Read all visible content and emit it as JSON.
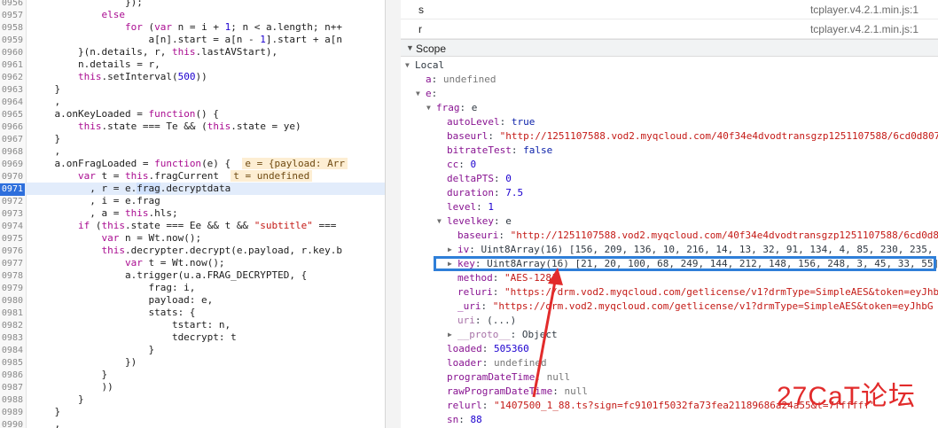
{
  "source": {
    "lines": [
      {
        "n": "0956",
        "html": "                <span>});</span>"
      },
      {
        "n": "0957",
        "html": "            <span class=\"k\">else</span>"
      },
      {
        "n": "0958",
        "html": "                <span class=\"k\">for</span> (<span class=\"k\">var</span> n = i + <span class=\"n\">1</span>; n &lt; a.length; n++"
      },
      {
        "n": "0959",
        "html": "                    a[n].start = a[n - <span class=\"n\">1</span>].start + a[n"
      },
      {
        "n": "0960",
        "html": "        }(n.details, r, <span class=\"k\">this</span>.lastAVStart),"
      },
      {
        "n": "0961",
        "html": "        n.details = r,"
      },
      {
        "n": "0962",
        "html": "        <span class=\"k\">this</span>.setInterval(<span class=\"n\">500</span>))"
      },
      {
        "n": "0963",
        "html": "    }"
      },
      {
        "n": "0964",
        "html": "    ,"
      },
      {
        "n": "0965",
        "html": "    a.onKeyLoaded = <span class=\"k\">function</span>() {"
      },
      {
        "n": "0966",
        "html": "        <span class=\"k\">this</span>.state === Te &amp;&amp; (<span class=\"k\">this</span>.state = ye)"
      },
      {
        "n": "0967",
        "html": "    }"
      },
      {
        "n": "0968",
        "html": "    ,"
      },
      {
        "n": "0969",
        "html": "    a.onFragLoaded = <span class=\"k\">function</span>(e) {  <span class=\"inline-val\">e = {payload: Arr</span>"
      },
      {
        "n": "0970",
        "html": "        <span class=\"k\">var</span> t = <span class=\"k\">this</span>.fragCurrent  <span class=\"inline-val\">t = undefined</span>"
      },
      {
        "n": "0971",
        "html": "          , r = e.<span class=\"sel\">frag</span>.decryptdata",
        "current": true
      },
      {
        "n": "0972",
        "html": "          , i = e.frag"
      },
      {
        "n": "0973",
        "html": "          , a = <span class=\"k\">this</span>.hls;"
      },
      {
        "n": "0974",
        "html": "        <span class=\"k\">if</span> (<span class=\"k\">this</span>.state === Ee &amp;&amp; t &amp;&amp; <span class=\"s\">\"subtitle\"</span> ==="
      },
      {
        "n": "0975",
        "html": "            <span class=\"k\">var</span> n = Wt.now();"
      },
      {
        "n": "0976",
        "html": "            <span class=\"k\">this</span>.decrypter.decrypt(e.payload, r.key.b"
      },
      {
        "n": "0977",
        "html": "                <span class=\"k\">var</span> t = Wt.now();"
      },
      {
        "n": "0978",
        "html": "                a.trigger(u.a.FRAG_DECRYPTED, {"
      },
      {
        "n": "0979",
        "html": "                    frag: i,"
      },
      {
        "n": "0980",
        "html": "                    payload: e,"
      },
      {
        "n": "0981",
        "html": "                    stats: {"
      },
      {
        "n": "0982",
        "html": "                        tstart: n,"
      },
      {
        "n": "0983",
        "html": "                        tdecrypt: t"
      },
      {
        "n": "0984",
        "html": "                    }"
      },
      {
        "n": "0985",
        "html": "                })"
      },
      {
        "n": "0986",
        "html": "            }"
      },
      {
        "n": "0987",
        "html": "            ))"
      },
      {
        "n": "0988",
        "html": "        }"
      },
      {
        "n": "0989",
        "html": "    }"
      },
      {
        "n": "0990",
        "html": "    ,"
      }
    ]
  },
  "call_stack": [
    {
      "fn": "s",
      "loc": "tcplayer.v4.2.1.min.js:1"
    },
    {
      "fn": "r",
      "loc": "tcplayer.v4.2.1.min.js:1"
    }
  ],
  "scope": {
    "header": "Scope",
    "rows": [
      {
        "i": 0,
        "arrow": "▼",
        "name": "Local",
        "val": "",
        "vc": "plain",
        "nc": "plain"
      },
      {
        "i": 1,
        "arrow": "",
        "name": "a",
        "val": "undefined",
        "vc": "vgray"
      },
      {
        "i": 1,
        "arrow": "▼",
        "name": "e",
        "val": "",
        "vc": "vobj"
      },
      {
        "i": 2,
        "arrow": "▼",
        "name": "frag",
        "val": "e",
        "vc": "vobj"
      },
      {
        "i": 3,
        "arrow": "",
        "name": "autoLevel",
        "val": "true",
        "vc": "vbool"
      },
      {
        "i": 3,
        "arrow": "",
        "name": "baseurl",
        "val": "\"http://1251107588.vod2.myqcloud.com/40f34e4dvodtransgzp1251107588/6cd0d807",
        "vc": "vstr"
      },
      {
        "i": 3,
        "arrow": "",
        "name": "bitrateTest",
        "val": "false",
        "vc": "vbool"
      },
      {
        "i": 3,
        "arrow": "",
        "name": "cc",
        "val": "0",
        "vc": "vnum"
      },
      {
        "i": 3,
        "arrow": "",
        "name": "deltaPTS",
        "val": "0",
        "vc": "vnum"
      },
      {
        "i": 3,
        "arrow": "",
        "name": "duration",
        "val": "7.5",
        "vc": "vnum"
      },
      {
        "i": 3,
        "arrow": "",
        "name": "level",
        "val": "1",
        "vc": "vnum"
      },
      {
        "i": 3,
        "arrow": "▼",
        "name": "levelkey",
        "val": "e",
        "vc": "vobj"
      },
      {
        "i": 4,
        "arrow": "",
        "name": "baseuri",
        "val": "\"http://1251107588.vod2.myqcloud.com/40f34e4dvodtransgzp1251107588/6cd0d8",
        "vc": "vstr"
      },
      {
        "i": 4,
        "arrow": "▶",
        "name": "iv",
        "val": "Uint8Array(16) [156, 209, 136, 10, 216, 14, 13, 32, 91, 134, 4, 85, 230, 235,",
        "vc": "vobj"
      },
      {
        "i": 4,
        "arrow": "▶",
        "name": "key",
        "val": "Uint8Array(16) [21, 20, 100, 68, 249, 144, 212, 148, 156, 248, 3, 45, 33, 55]",
        "vc": "vobj"
      },
      {
        "i": 4,
        "arrow": "",
        "name": "method",
        "val": "\"AES-128\"",
        "vc": "vstr"
      },
      {
        "i": 4,
        "arrow": "",
        "name": "reluri",
        "val": "\"https://drm.vod2.myqcloud.com/getlicense/v1?drmType=SimpleAES&token=eyJhb",
        "vc": "vstr"
      },
      {
        "i": 4,
        "arrow": "",
        "name": "_uri",
        "val": "\"https://drm.vod2.myqcloud.com/getlicense/v1?drmType=SimpleAES&token=eyJhbG",
        "vc": "vstr"
      },
      {
        "i": 4,
        "arrow": "",
        "name": "uri",
        "val": "(...)",
        "vc": "vobj",
        "dim": true
      },
      {
        "i": 4,
        "arrow": "▶",
        "name": "__proto__",
        "val": "Object",
        "vc": "vobj",
        "dim": true
      },
      {
        "i": 3,
        "arrow": "",
        "name": "loaded",
        "val": "505360",
        "vc": "vnum"
      },
      {
        "i": 3,
        "arrow": "",
        "name": "loader",
        "val": "undefined",
        "vc": "vgray"
      },
      {
        "i": 3,
        "arrow": "",
        "name": "programDateTime",
        "val": "null",
        "vc": "vgray"
      },
      {
        "i": 3,
        "arrow": "",
        "name": "rawProgramDateTime",
        "val": "null",
        "vc": "vgray"
      },
      {
        "i": 3,
        "arrow": "",
        "name": "relurl",
        "val": "\"1407500_1_88.ts?sign=fc9101f5032fa73fea21189686a24a55&t=7ffffff\"",
        "vc": "vstr"
      },
      {
        "i": 3,
        "arrow": "",
        "name": "sn",
        "val": "88",
        "vc": "vnum"
      }
    ]
  },
  "watermark": "27CaT论坛",
  "colors": {
    "highlight_box": "#2f7fd8",
    "arrow": "#e22b2b",
    "current_line": "#2e6fdc"
  }
}
